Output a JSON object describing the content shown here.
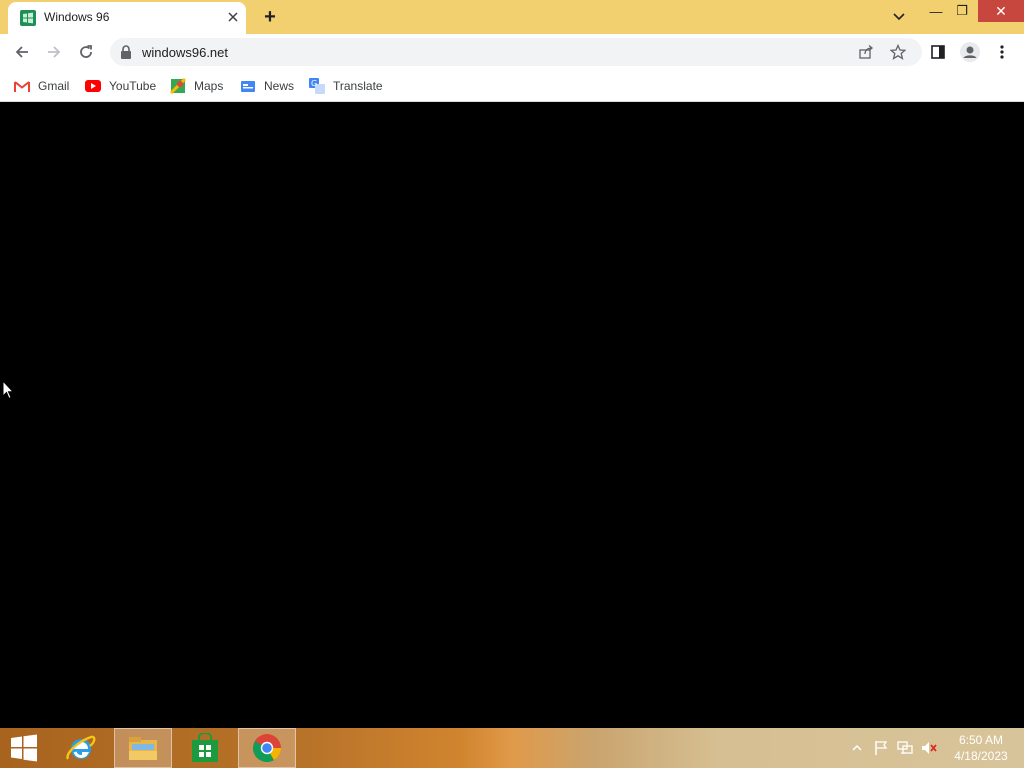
{
  "browser": {
    "tab": {
      "title": "Windows 96",
      "favicon": "windows96-icon"
    },
    "new_tab_symbol": "+",
    "window_controls": {
      "minimize": "—",
      "restore": "❐",
      "close": "✕"
    },
    "address": {
      "url": "windows96.net"
    },
    "bookmarks": [
      {
        "label": "Gmail",
        "icon": "gmail-icon"
      },
      {
        "label": "YouTube",
        "icon": "youtube-icon"
      },
      {
        "label": "Maps",
        "icon": "maps-icon"
      },
      {
        "label": "News",
        "icon": "news-icon"
      },
      {
        "label": "Translate",
        "icon": "translate-icon"
      }
    ]
  },
  "taskbar": {
    "apps": [
      {
        "name": "start",
        "icon": "windows-start-icon"
      },
      {
        "name": "internet-explorer",
        "icon": "internet-explorer-icon"
      },
      {
        "name": "file-explorer",
        "icon": "file-explorer-icon"
      },
      {
        "name": "store",
        "icon": "store-icon"
      },
      {
        "name": "chrome",
        "icon": "chrome-icon"
      }
    ],
    "clock": {
      "time": "6:50 AM",
      "date": "4/18/2023"
    }
  },
  "colors": {
    "tab_strip": "#f2cf6f",
    "close_button": "#c7473e",
    "page_background": "#000000"
  }
}
